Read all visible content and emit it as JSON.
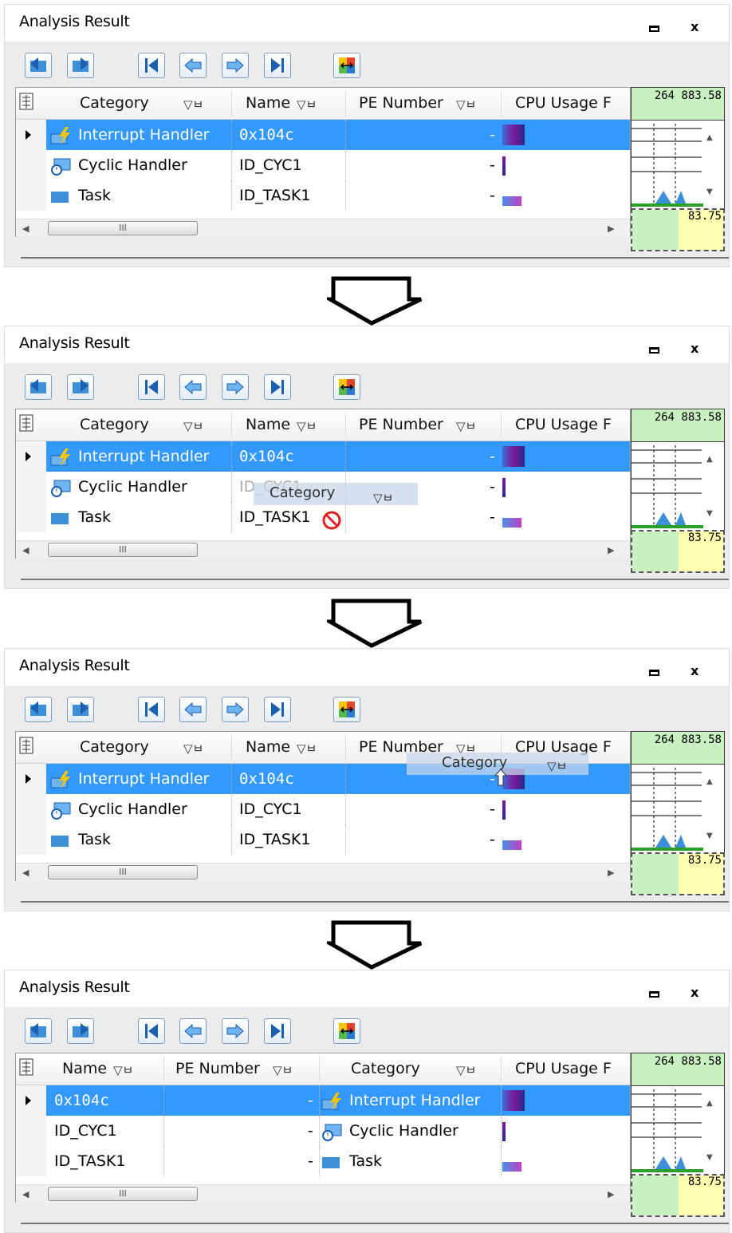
{
  "window": {
    "title": "Analysis Result",
    "minimize_icon": "minimize-icon",
    "close_label": "x"
  },
  "toolbar": {
    "buttons": [
      {
        "name": "back-button",
        "icon": "back-icon"
      },
      {
        "name": "forward-button",
        "icon": "forward-icon"
      },
      {
        "name": "first-button",
        "icon": "first-icon"
      },
      {
        "name": "previous-button",
        "icon": "previous-icon"
      },
      {
        "name": "next-button",
        "icon": "next-icon"
      },
      {
        "name": "last-button",
        "icon": "last-icon"
      },
      {
        "name": "sync-button",
        "icon": "sync-icon"
      }
    ]
  },
  "headers": {
    "category": "Category",
    "name": "Name",
    "pe_number": "PE Number",
    "cpu_usage": "CPU Usage F",
    "filter_pin": "▽ㅂ"
  },
  "rows": [
    {
      "category": "Interrupt Handler",
      "name": "0x104c",
      "pe": "-",
      "icon": "interrupt-handler-icon"
    },
    {
      "category": "Cyclic Handler",
      "name": "ID_CYC1",
      "pe": "-",
      "icon": "cyclic-handler-icon"
    },
    {
      "category": "Task",
      "name": "ID_TASK1",
      "pe": "-",
      "icon": "task-icon"
    }
  ],
  "scroll": {
    "thumb_label": "III"
  },
  "side": {
    "top_value": "264 883.58",
    "bottom_value": "83.75"
  },
  "drag": {
    "ghost_label": "Category"
  },
  "colors": {
    "selection": "#3399ff",
    "side_green": "#c8f0c0",
    "side_yellow": "#ffffb0"
  }
}
